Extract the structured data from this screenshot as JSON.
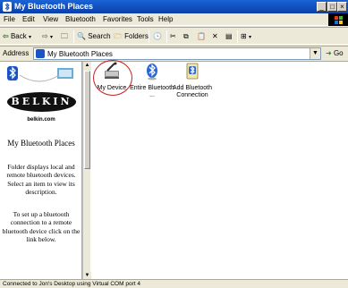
{
  "window": {
    "title": "My Bluetooth Places"
  },
  "menu": {
    "items": [
      "File",
      "Edit",
      "View",
      "Bluetooth",
      "Favorites",
      "Tools",
      "Help"
    ]
  },
  "toolbar": {
    "back_label": "Back",
    "search_label": "Search",
    "folders_label": "Folders"
  },
  "address": {
    "label": "Address",
    "value": "My Bluetooth Places",
    "go_label": "Go"
  },
  "left_pane": {
    "brand": "BELKIN",
    "url": "belkin.com",
    "title": "My Bluetooth Places",
    "description": "Folder displays local and remote bluetooth devices. Select an item to view its description.",
    "instructions": "To set up a bluetooth connection to a remote bluetooth device click on the link below."
  },
  "items": [
    {
      "label": "My Device",
      "icon": "my-device-icon"
    },
    {
      "label": "Entire Bluetooth ...",
      "icon": "bluetooth-globe-icon"
    },
    {
      "label": "Add Bluetooth Connection",
      "icon": "add-connection-icon"
    }
  ],
  "status": {
    "text": "Connected to Jon's Desktop using Virtual COM port 4"
  },
  "colors": {
    "titlebar": "#0a3fa8",
    "highlight_circle": "#c81e1e",
    "bluetooth": "#1a54c4"
  }
}
